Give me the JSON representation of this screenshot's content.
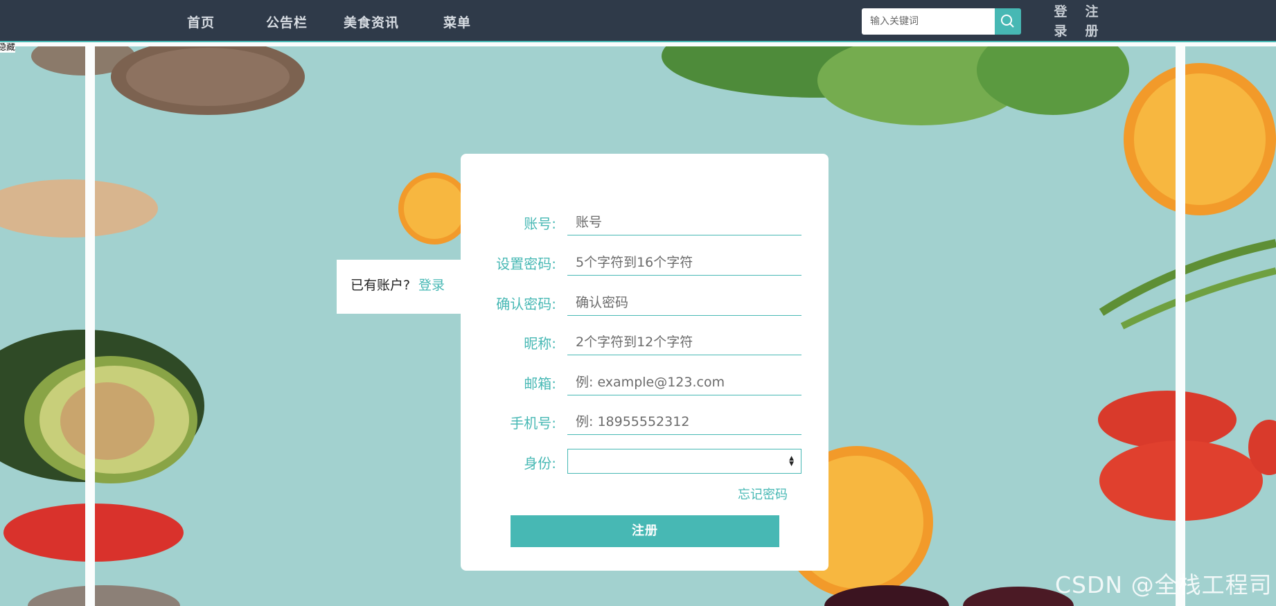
{
  "nav": {
    "items": [
      {
        "label": "首页"
      },
      {
        "label": "公告栏"
      },
      {
        "label": "美食资讯"
      },
      {
        "label": "菜单"
      }
    ],
    "search_placeholder": "输入关键词",
    "login_label": "登录",
    "register_label": "注册",
    "hidden_label": "隐藏"
  },
  "side": {
    "question": "已有账户?",
    "login_link": "登录"
  },
  "form": {
    "account_label": "账号:",
    "account_placeholder": "账号",
    "password_label": "设置密码:",
    "password_placeholder": "5个字符到16个字符",
    "confirm_label": "确认密码:",
    "confirm_placeholder": "确认密码",
    "nickname_label": "昵称:",
    "nickname_placeholder": "2个字符到12个字符",
    "email_label": "邮箱:",
    "email_placeholder": "例: example@123.com",
    "phone_label": "手机号:",
    "phone_placeholder": "例: 18955552312",
    "identity_label": "身份:",
    "identity_value": "",
    "forgot_label": "忘记密码",
    "submit_label": "注册"
  },
  "watermark": "CSDN @全栈工程司",
  "colors": {
    "accent": "#47b8b4",
    "nav_bg": "#2f3a49",
    "page_bg": "#a2d1cf"
  },
  "icons": {
    "search": "search-icon",
    "select_arrows": "updown-arrows-icon"
  }
}
